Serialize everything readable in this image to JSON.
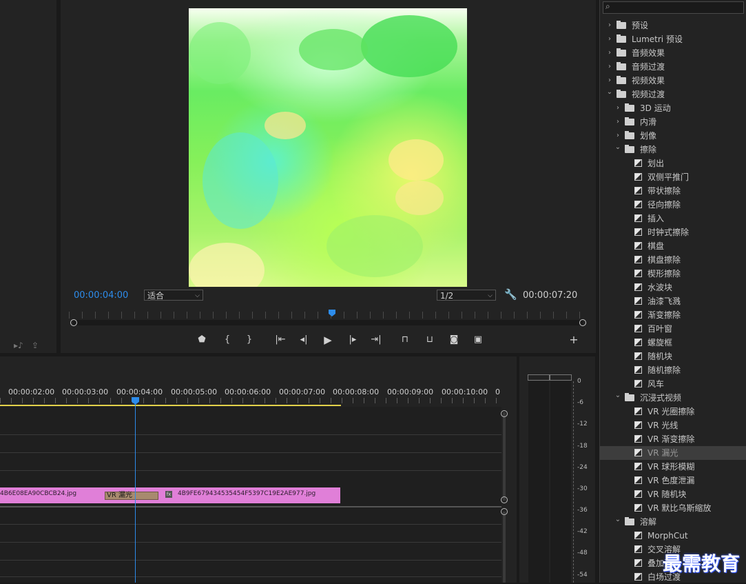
{
  "monitor": {
    "current_timecode": "00:00:04:00",
    "fit_select": "适合",
    "resolution_select": "1/2",
    "duration_timecode": "00:00:07:20"
  },
  "timeline": {
    "ruler": [
      "00:00:02:00",
      "00:00:03:00",
      "00:00:04:00",
      "00:00:05:00",
      "00:00:06:00",
      "00:00:07:00",
      "00:00:08:00",
      "00:00:09:00",
      "00:00:10:00",
      "0"
    ],
    "clip_left": "4B6E08EA90CBCB24.jpg",
    "transition_label": "VR 漏光",
    "clip_fx_badge": "fx",
    "clip_right": "4B9FE679434535454F5397C19E2AE977.jpg"
  },
  "meter": {
    "db_labels": [
      "0",
      "-6",
      "-12",
      "-18",
      "-24",
      "-30",
      "-36",
      "-42",
      "-48",
      "-54"
    ]
  },
  "effects": {
    "items": [
      {
        "label": "预设",
        "type": "folder",
        "level": 0,
        "expanded": false
      },
      {
        "label": "Lumetri 预设",
        "type": "folder",
        "level": 0,
        "expanded": false
      },
      {
        "label": "音频效果",
        "type": "folder",
        "level": 0,
        "expanded": false
      },
      {
        "label": "音频过渡",
        "type": "folder",
        "level": 0,
        "expanded": false
      },
      {
        "label": "视频效果",
        "type": "folder",
        "level": 0,
        "expanded": false
      },
      {
        "label": "视频过渡",
        "type": "folder",
        "level": 0,
        "expanded": true
      },
      {
        "label": "3D 运动",
        "type": "folder",
        "level": 1,
        "expanded": false
      },
      {
        "label": "内滑",
        "type": "folder",
        "level": 1,
        "expanded": false
      },
      {
        "label": "划像",
        "type": "folder",
        "level": 1,
        "expanded": false
      },
      {
        "label": "擦除",
        "type": "folder",
        "level": 1,
        "expanded": true
      },
      {
        "label": "划出",
        "type": "effect",
        "level": 2
      },
      {
        "label": "双侧平推门",
        "type": "effect",
        "level": 2
      },
      {
        "label": "带状擦除",
        "type": "effect",
        "level": 2
      },
      {
        "label": "径向擦除",
        "type": "effect",
        "level": 2
      },
      {
        "label": "插入",
        "type": "effect",
        "level": 2
      },
      {
        "label": "时钟式擦除",
        "type": "effect",
        "level": 2
      },
      {
        "label": "棋盘",
        "type": "effect",
        "level": 2
      },
      {
        "label": "棋盘擦除",
        "type": "effect",
        "level": 2
      },
      {
        "label": "楔形擦除",
        "type": "effect",
        "level": 2
      },
      {
        "label": "水波块",
        "type": "effect",
        "level": 2
      },
      {
        "label": "油漆飞溅",
        "type": "effect",
        "level": 2
      },
      {
        "label": "渐变擦除",
        "type": "effect",
        "level": 2
      },
      {
        "label": "百叶窗",
        "type": "effect",
        "level": 2
      },
      {
        "label": "螺旋框",
        "type": "effect",
        "level": 2
      },
      {
        "label": "随机块",
        "type": "effect",
        "level": 2
      },
      {
        "label": "随机擦除",
        "type": "effect",
        "level": 2
      },
      {
        "label": "风车",
        "type": "effect",
        "level": 2
      },
      {
        "label": "沉浸式视频",
        "type": "folder",
        "level": 1,
        "expanded": true
      },
      {
        "label": "VR 光圈擦除",
        "type": "effect",
        "level": 2
      },
      {
        "label": "VR 光线",
        "type": "effect",
        "level": 2
      },
      {
        "label": "VR 渐变擦除",
        "type": "effect",
        "level": 2
      },
      {
        "label": "VR 漏光",
        "type": "effect",
        "level": 2,
        "selected": true
      },
      {
        "label": "VR 球形模糊",
        "type": "effect",
        "level": 2
      },
      {
        "label": "VR 色度泄漏",
        "type": "effect",
        "level": 2
      },
      {
        "label": "VR 随机块",
        "type": "effect",
        "level": 2
      },
      {
        "label": "VR 默比乌斯缩放",
        "type": "effect",
        "level": 2
      },
      {
        "label": "溶解",
        "type": "folder",
        "level": 1,
        "expanded": true
      },
      {
        "label": "MorphCut",
        "type": "effect",
        "level": 2
      },
      {
        "label": "交叉溶解",
        "type": "effect",
        "level": 2
      },
      {
        "label": "叠加溶解",
        "type": "effect",
        "level": 2
      },
      {
        "label": "白场过渡",
        "type": "effect",
        "level": 2
      }
    ]
  },
  "watermark": "最需教育",
  "colors": {
    "accent_blue": "#2d8ceb",
    "clip_pink": "#e07fd8",
    "work_area_yellow": "#e3d24a",
    "selected_row": "#3d3d3d"
  }
}
